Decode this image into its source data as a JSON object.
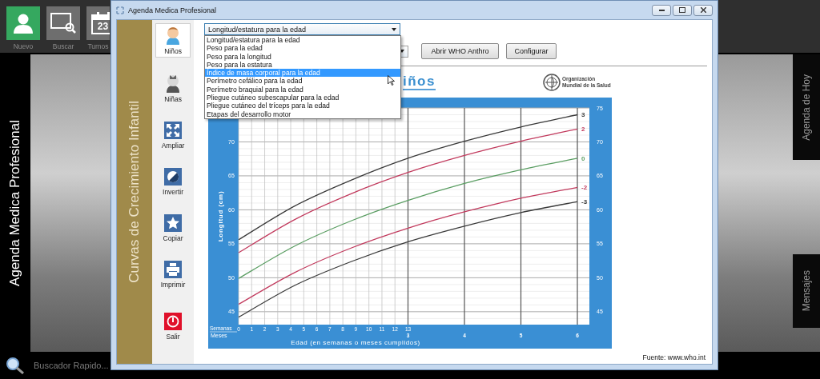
{
  "desktop": {
    "app_title": "Agenda Medica Profesional",
    "launcher": [
      {
        "label": "Nuevo",
        "kind": "user",
        "color": "#35a85f"
      },
      {
        "label": "Buscar",
        "kind": "search",
        "color": "#6e6e6e"
      },
      {
        "label": "Turnos",
        "kind": "calendar",
        "icon_text": "23",
        "color": "#6e6e6e"
      }
    ],
    "side_tabs": [
      "Agenda de Hoy",
      "Mensajes"
    ],
    "quick_search": {
      "placeholder": "Buscador Rapido..."
    }
  },
  "window": {
    "title": "Agenda Medica Profesional",
    "section_title": "Curvas de Crecimiento Infantil",
    "toolbar": [
      {
        "label": "Niños",
        "kind": "boy",
        "selected": true
      },
      {
        "label": "Niñas",
        "kind": "girl",
        "selected": false
      },
      {
        "label": "Ampliar",
        "kind": "expand",
        "selected": false
      },
      {
        "label": "Invertir",
        "kind": "invert",
        "selected": false
      },
      {
        "label": "Copiar",
        "kind": "star",
        "selected": false
      },
      {
        "label": "Imprimir",
        "kind": "printer",
        "selected": false
      },
      {
        "label": "Salir",
        "kind": "power",
        "selected": false
      }
    ],
    "indicator_select": {
      "value": "Longitud/estatura para la edad",
      "expanded": true,
      "options": [
        {
          "label": "Longitud/estatura para la edad",
          "highlighted": false
        },
        {
          "label": "Peso para la edad",
          "highlighted": false
        },
        {
          "label": "Peso para la longitud",
          "highlighted": false
        },
        {
          "label": "Peso para la estatura",
          "highlighted": false
        },
        {
          "label": "Índice de masa corporal para la edad",
          "highlighted": true
        },
        {
          "label": "Perímetro cefálico para la edad",
          "highlighted": false
        },
        {
          "label": "Perímetro braquial para la edad",
          "highlighted": false
        },
        {
          "label": "Pliegue cutáneo subescapular para la edad",
          "highlighted": false
        },
        {
          "label": "Pliegue cutáneo del tríceps para la edad",
          "highlighted": false
        },
        {
          "label": "Etapas del desarrollo motor",
          "highlighted": false
        }
      ]
    },
    "buttons": [
      "Abrir WHO Anthro",
      "Configurar"
    ],
    "chart_heading": "iños",
    "org_logo": [
      "Organización",
      "Mundial de la Salud"
    ],
    "chart": {
      "left_yticks": [
        "70",
        "65",
        "60",
        "55",
        "50",
        "45"
      ],
      "weeks_label": "Semanas",
      "months_label": "Meses",
      "week_ticks": [
        "0",
        "1",
        "2",
        "3",
        "4",
        "5",
        "6",
        "7",
        "8",
        "9",
        "10",
        "11",
        "12",
        "13"
      ],
      "chart_data": {
        "type": "line",
        "grid": true,
        "xlabel": "Edad (en semanas o meses cumplidos)",
        "ylabel": "Longitud (cm)",
        "x": [
          0,
          1,
          2,
          3,
          4,
          5,
          6
        ],
        "xlim": [
          0,
          6
        ],
        "ylim": [
          43.1,
          75
        ],
        "xticks": [
          3,
          4,
          5,
          6
        ],
        "yticks": [
          45,
          50,
          55,
          60,
          65,
          70,
          75
        ],
        "series": [
          {
            "name": "3",
            "color": "#3a3a3a",
            "values": [
              55.6,
              60.6,
              64.4,
              67.6,
              70.1,
              72.2,
              74.0
            ]
          },
          {
            "name": "2",
            "color": "#c23b5e",
            "values": [
              53.7,
              58.6,
              62.4,
              65.5,
              68.0,
              70.1,
              71.9
            ]
          },
          {
            "name": "0",
            "color": "#5b9e63",
            "values": [
              49.9,
              54.7,
              58.4,
              61.4,
              63.9,
              65.9,
              67.6
            ]
          },
          {
            "name": "-2",
            "color": "#c23b5e",
            "values": [
              46.1,
              50.8,
              54.4,
              57.3,
              59.7,
              61.7,
              63.3
            ]
          },
          {
            "name": "-3",
            "color": "#3a3a3a",
            "values": [
              44.2,
              48.9,
              52.4,
              55.3,
              57.6,
              59.6,
              61.2
            ]
          }
        ]
      }
    },
    "source": "Fuente: www.who.int"
  }
}
